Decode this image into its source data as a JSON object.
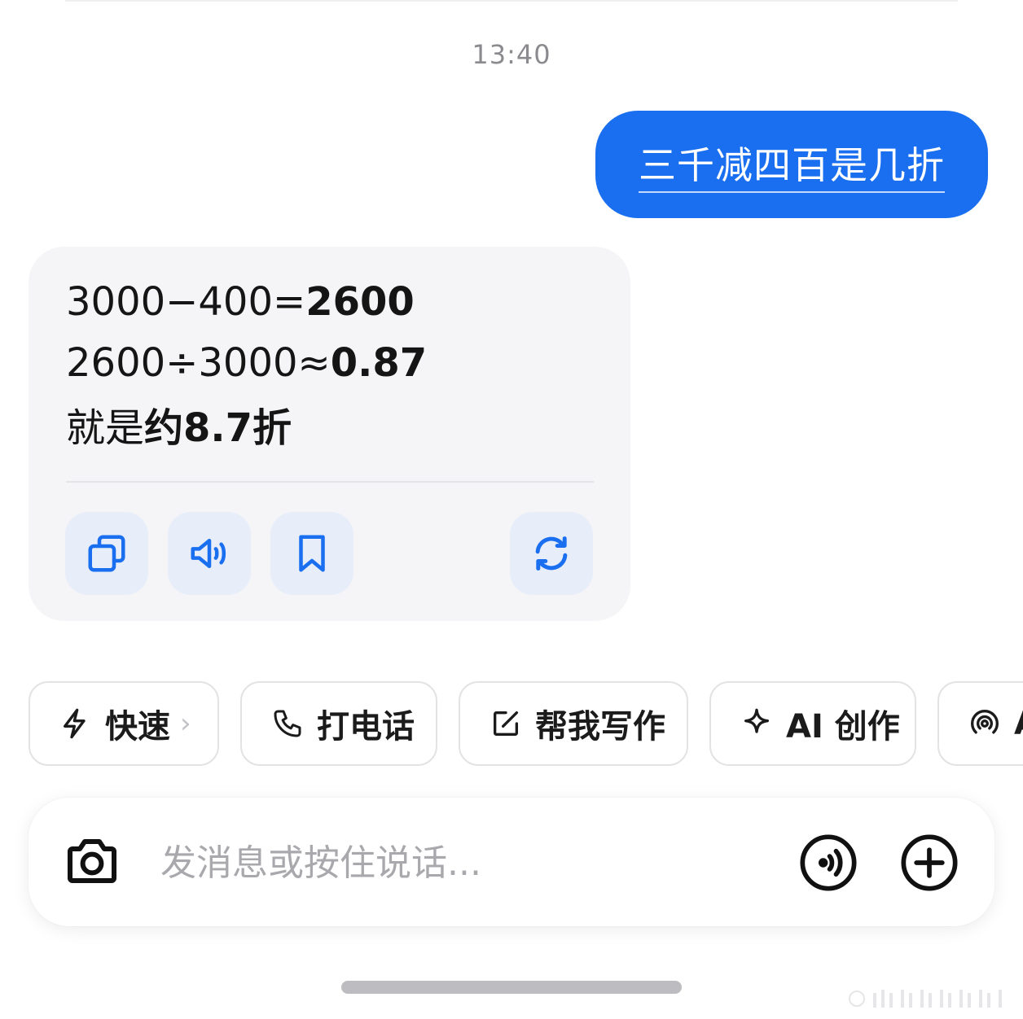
{
  "chat": {
    "timestamp": "13:40",
    "user_message": "三千减四百是几折",
    "ai_reply": {
      "line1_prefix": "3000−400=",
      "line1_result": "2600",
      "line2_prefix": "2600÷3000≈",
      "line2_result": "0.87",
      "line3_prefix": "就是",
      "line3_result": "约8.7折"
    },
    "actions": [
      {
        "name": "copy",
        "icon": "copy-icon"
      },
      {
        "name": "read-aloud",
        "icon": "speaker-icon"
      },
      {
        "name": "bookmark",
        "icon": "bookmark-icon"
      },
      {
        "name": "regenerate",
        "icon": "refresh-icon"
      }
    ]
  },
  "quick_chips": [
    {
      "label": "快速",
      "icon": "lightning-icon",
      "chevron": "›"
    },
    {
      "label": "打电话",
      "icon": "phone-icon"
    },
    {
      "label": "帮我写作",
      "icon": "edit-icon"
    },
    {
      "label": "AI 创作",
      "icon": "sparkle-icon"
    },
    {
      "label": "A",
      "icon": "broadcast-icon"
    }
  ],
  "input": {
    "placeholder": "发消息或按住说话...",
    "value": ""
  },
  "colors": {
    "accent": "#1a6ef0",
    "card_bg": "#f5f5f7",
    "action_bg": "#e7edf9"
  }
}
